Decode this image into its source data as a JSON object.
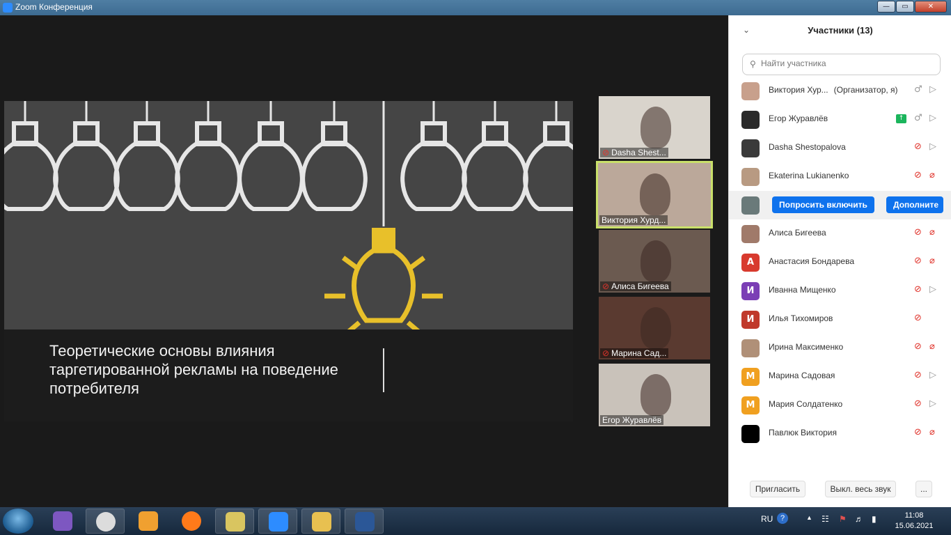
{
  "window": {
    "title": "Zoom Конференция",
    "controls": {
      "minimize": "—",
      "maximize": "▭",
      "close": "✕"
    }
  },
  "slide": {
    "title": "Теоретические основы влияния таргетированной рекламы на поведение потребителя"
  },
  "thumbnails": [
    {
      "name": "Dasha Shest...",
      "muted": true,
      "active": false,
      "bg": "#d9d4cc"
    },
    {
      "name": "Виктория  Хурд...",
      "muted": false,
      "active": true,
      "bg": "#bba89a"
    },
    {
      "name": "Алиса Бигеева",
      "muted": true,
      "active": false,
      "bg": "#6b5a50"
    },
    {
      "name": "Марина Сад...",
      "muted": true,
      "active": false,
      "bg": "#5a3a30"
    },
    {
      "name": "Егор Журавлёв",
      "muted": false,
      "active": false,
      "bg": "#c9c2ba"
    }
  ],
  "panel": {
    "collapse_icon": "chevron-down-icon",
    "title": "Участники (13)",
    "search_placeholder": "Найти участника",
    "participants": [
      {
        "name": "Виктория  Хур...",
        "role": "(Организатор, я)",
        "avatar_color": "#c8a08c",
        "avatar_letter": "",
        "mic": "on",
        "cam": "on"
      },
      {
        "name": "Егор Журавлёв",
        "role": "",
        "avatar_color": "#2a2a2a",
        "avatar_letter": "",
        "mic": "on",
        "cam": "on",
        "sharing": true
      },
      {
        "name": "Dasha Shestopalova",
        "role": "",
        "avatar_color": "#3a3a3a",
        "avatar_letter": "",
        "mic": "off",
        "cam": "on"
      },
      {
        "name": "Ekaterina Lukianenko",
        "role": "",
        "avatar_color": "#b89a82",
        "avatar_letter": "",
        "mic": "off",
        "cam": "off"
      },
      {
        "name": "",
        "role": "",
        "avatar_color": "#6a7a7a",
        "avatar_letter": "",
        "highlight": true,
        "actions": [
          "Попросить включить",
          "Дополните"
        ]
      },
      {
        "name": "Алиса Бигеева",
        "role": "",
        "avatar_color": "#a07a6a",
        "avatar_letter": "",
        "mic": "off",
        "cam": "off"
      },
      {
        "name": "Анастасия Бондарева",
        "role": "",
        "avatar_color": "#d83a2e",
        "avatar_letter": "А",
        "mic": "off",
        "cam": "off"
      },
      {
        "name": "Иванна Мищенко",
        "role": "",
        "avatar_color": "#7b3fb5",
        "avatar_letter": "И",
        "mic": "off",
        "cam": "on"
      },
      {
        "name": "Илья Тихомиров",
        "role": "",
        "avatar_color": "#c0392b",
        "avatar_letter": "И",
        "mic": "off",
        "cam": "none"
      },
      {
        "name": "Ирина Максименко",
        "role": "",
        "avatar_color": "#b09078",
        "avatar_letter": "",
        "mic": "off",
        "cam": "off"
      },
      {
        "name": "Марина Садовая",
        "role": "",
        "avatar_color": "#f0a020",
        "avatar_letter": "М",
        "mic": "off",
        "cam": "on"
      },
      {
        "name": "Мария Солдатенко",
        "role": "",
        "avatar_color": "#f0a020",
        "avatar_letter": "М",
        "mic": "off",
        "cam": "on"
      },
      {
        "name": "Павлюк Виктория",
        "role": "",
        "avatar_color": "#000000",
        "avatar_letter": "",
        "mic": "off",
        "cam": "off"
      }
    ],
    "footer": {
      "invite": "Пригласить",
      "mute_all": "Выкл. весь звук",
      "more": "..."
    }
  },
  "taskbar": {
    "language": "RU",
    "time": "11:08",
    "date": "15.06.2021",
    "apps": [
      "viber-icon",
      "chrome-icon",
      "media-player-icon",
      "firefox-icon",
      "security-shield-icon",
      "zoom-icon",
      "file-explorer-icon",
      "word-icon"
    ]
  }
}
